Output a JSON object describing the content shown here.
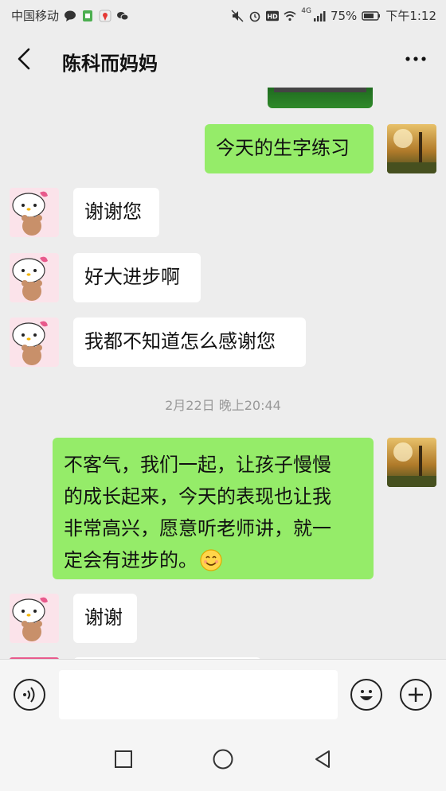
{
  "status_bar": {
    "carrier": "中国移动",
    "signal_label": "4G",
    "battery_percent": "75%",
    "time": "下午1:12",
    "icons": [
      "message-icon",
      "sim-icon",
      "location-icon",
      "wechat-icon",
      "mute-icon",
      "alarm-icon",
      "hd-icon",
      "wifi-icon",
      "signal-icon",
      "battery-icon"
    ]
  },
  "header": {
    "title": "陈科而妈妈",
    "back_icon": "chevron-left-icon",
    "more_icon": "more-dots-icon"
  },
  "messages": [
    {
      "side": "right",
      "type": "image",
      "text": ""
    },
    {
      "side": "right",
      "type": "text",
      "text": "今天的生字练习"
    },
    {
      "side": "left",
      "type": "text",
      "text": "谢谢您"
    },
    {
      "side": "left",
      "type": "text",
      "text": "好大进步啊"
    },
    {
      "side": "left",
      "type": "text",
      "text": "我都不知道怎么感谢您"
    },
    {
      "type": "timestamp",
      "text": "2月22日 晚上20:44"
    },
    {
      "side": "right",
      "type": "text",
      "lines": [
        "不客气，我们一起，让孩子慢慢",
        "的成长起来，今天的表现也让我",
        "非常高兴，愿意听老师讲，就一",
        "定会有进步的。"
      ],
      "emoji": "smile-emoji-icon"
    },
    {
      "side": "left",
      "type": "text",
      "text": "谢谢"
    }
  ],
  "input_bar": {
    "voice_icon": "voice-icon",
    "emoji_icon": "emoji-icon",
    "add_icon": "plus-icon"
  },
  "nav_bar": {
    "icons": [
      "recent-apps-icon",
      "home-icon",
      "back-icon"
    ]
  },
  "colors": {
    "background": "#ededed",
    "my_bubble": "#95ec69",
    "their_bubble": "#ffffff",
    "timestamp": "#999999"
  }
}
